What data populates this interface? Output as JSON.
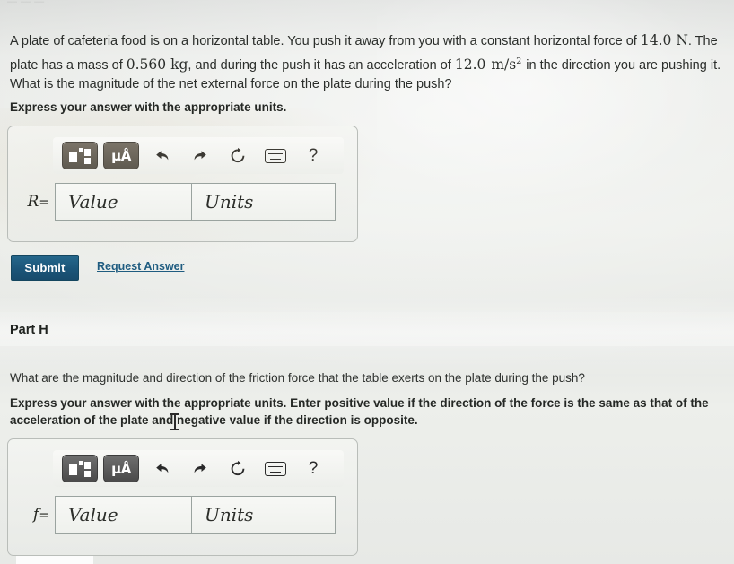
{
  "page": {
    "top_fragment": "— — —"
  },
  "problem": {
    "sentence_1a": "A plate of cafeteria food is on a horizontal table. You push it away from you with a constant horizontal force of ",
    "force_value": "14.0",
    "force_unit": "N",
    "sentence_1b": ". The plate has a mass of ",
    "mass_value": "0.560",
    "mass_unit": "kg",
    "sentence_1c": ", and during the push it has an acceleration of ",
    "accel_value": "12.0",
    "accel_unit_num": "m",
    "accel_unit_den": "s",
    "accel_unit_exp": "2",
    "sentence_1d": " in the direction you are pushing it. What is the magnitude of the net external force on the plate during the push?",
    "instruction": "Express your answer with the appropriate units."
  },
  "answer_a": {
    "variable": "R",
    "equals": "=",
    "value_placeholder": "Value",
    "units_placeholder": "Units",
    "value_current": "",
    "units_current": "",
    "toolbar": [
      {
        "name": "template-icon",
        "label": "template"
      },
      {
        "name": "units-icon",
        "label": "μÅ"
      },
      {
        "name": "undo-icon",
        "label": "undo"
      },
      {
        "name": "redo-icon",
        "label": "redo"
      },
      {
        "name": "reset-icon",
        "label": "reset"
      },
      {
        "name": "keyboard-icon",
        "label": "keyboard"
      },
      {
        "name": "help-icon",
        "label": "?"
      }
    ]
  },
  "actions": {
    "submit_label": "Submit",
    "request_answer_label": "Request Answer"
  },
  "part_h": {
    "title": "Part H",
    "question": "What are the magnitude and direction of the friction force that the table exerts on the plate during the push?",
    "instruction": "Express your answer with the appropriate units. Enter positive value if the direction of the force is the same as that of the acceleration of the plate and negative value if the direction is opposite."
  },
  "answer_b": {
    "variable": "f",
    "equals": "=",
    "value_placeholder": "Value",
    "units_placeholder": "Units",
    "value_current": "",
    "units_current": ""
  },
  "colors": {
    "page_bg": "#e6e8e5",
    "submit_bg": "#1b5579",
    "link": "#1f5c80",
    "text": "#2b2e2b",
    "field_border": "#9aa39f",
    "panel_border": "#b9bdb9"
  },
  "labels": {
    "help_glyph": "?",
    "mu_angstrom": "μÅ"
  }
}
